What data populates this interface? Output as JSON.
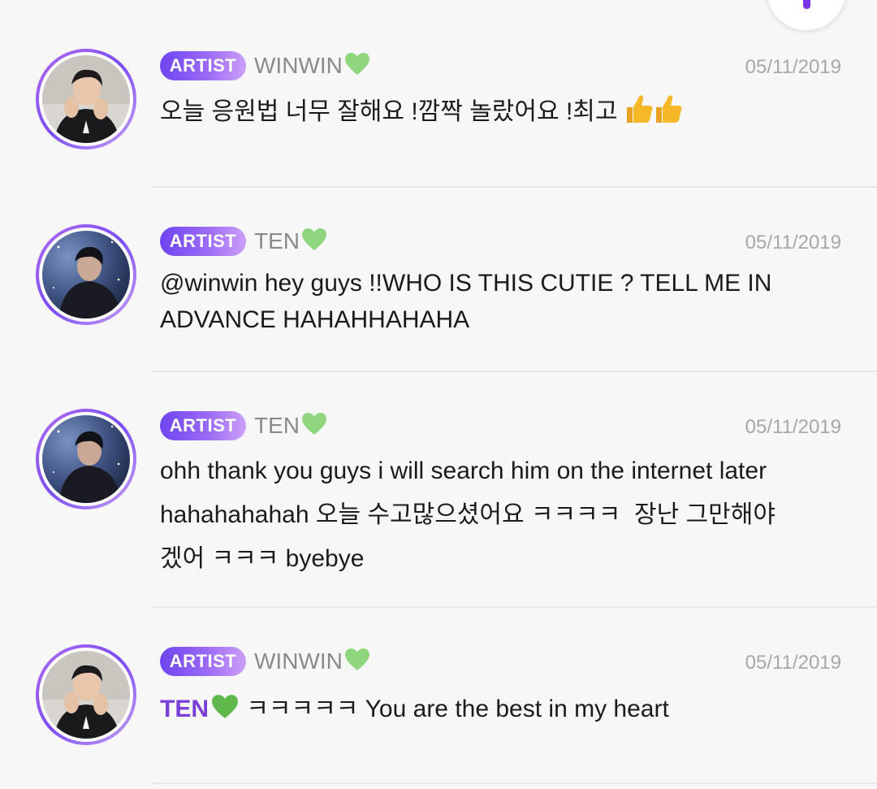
{
  "fab": {
    "icon": "compose-icon"
  },
  "comments": [
    {
      "badge": "ARTIST",
      "author": "WINWIN",
      "date": "05/11/2019",
      "text": "오늘 응원법 너무 잘해요 !깜짝 놀랐어요 !최고 ",
      "avatar": "winwin-avatar"
    },
    {
      "badge": "ARTIST",
      "author": "TEN",
      "date": "05/11/2019",
      "line1": "@winwin hey guys !!WHO IS THIS CUTIE ? TELL ME IN",
      "line2": "ADVANCE HAHAHHAHAHA",
      "avatar": "ten-avatar"
    },
    {
      "badge": "ARTIST",
      "author": "TEN",
      "date": "05/11/2019",
      "line1": "ohh thank you guys i will search him on the internet later",
      "line2": "hahahahahah 오늘 수고많으셨어요 ㅋㅋㅋㅋ  장난 그만해야",
      "line3": "겠어 ㅋㅋㅋ byebye",
      "avatar": "ten-avatar"
    },
    {
      "badge": "ARTIST",
      "author": "WINWIN",
      "date": "05/11/2019",
      "mention": "TEN",
      "text": " ㅋㅋㅋㅋㅋ You are the best in my heart",
      "avatar": "winwin-avatar"
    }
  ],
  "colors": {
    "accent": "#7b3fd9",
    "badge_start": "#6e45f0",
    "badge_end": "#cd9ff7",
    "heart": "#8fd67f",
    "thumb": "#f6b827"
  }
}
